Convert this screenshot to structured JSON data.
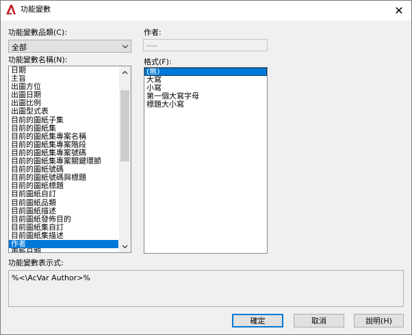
{
  "window": {
    "title": "功能變數",
    "close_glyph": "✕"
  },
  "category": {
    "label": "功能變數品類(C):",
    "selected": "全部"
  },
  "names": {
    "label": "功能變數名稱(N):",
    "items": [
      "日期",
      "主旨",
      "出圖方位",
      "出圖日期",
      "出圖比例",
      "出圖型式表",
      "目前的圖紙子集",
      "目前的圖紙集",
      "目前的圖紙集專案名稱",
      "目前的圖紙集專案階段",
      "目前的圖紙集專案號碼",
      "目前的圖紙集專案關鍵環節",
      "目前的圖紙號碼",
      "目前的圖紙號碼與標題",
      "目前的圖紙標題",
      "目前圖紙自訂",
      "目前圖紙品類",
      "目前圖紙描述",
      "目前圖紙發佈目的",
      "目前圖紙集自訂",
      "目前圖紙集描述",
      "作者",
      "更新日期"
    ],
    "selected_index": 21
  },
  "author": {
    "label": "作者:",
    "value": "----"
  },
  "format": {
    "label": "格式(F):",
    "items": [
      "(無)",
      "大寫",
      "小寫",
      "第一個大寫字母",
      "標題大小寫"
    ],
    "selected_index": 0
  },
  "expression": {
    "label": "功能變數表示式:",
    "value": "%<\\AcVar Author>%"
  },
  "buttons": {
    "ok": "確定",
    "cancel": "取消",
    "help": "說明(H)"
  },
  "colors": {
    "selection": "#0078d7",
    "app_icon": "#c0232c"
  },
  "icons": {
    "app": "autocad-logo-icon",
    "close": "close-icon",
    "dropdown": "chevron-down-icon",
    "scroll_up": "chevron-up-icon",
    "scroll_down": "chevron-down-icon"
  }
}
